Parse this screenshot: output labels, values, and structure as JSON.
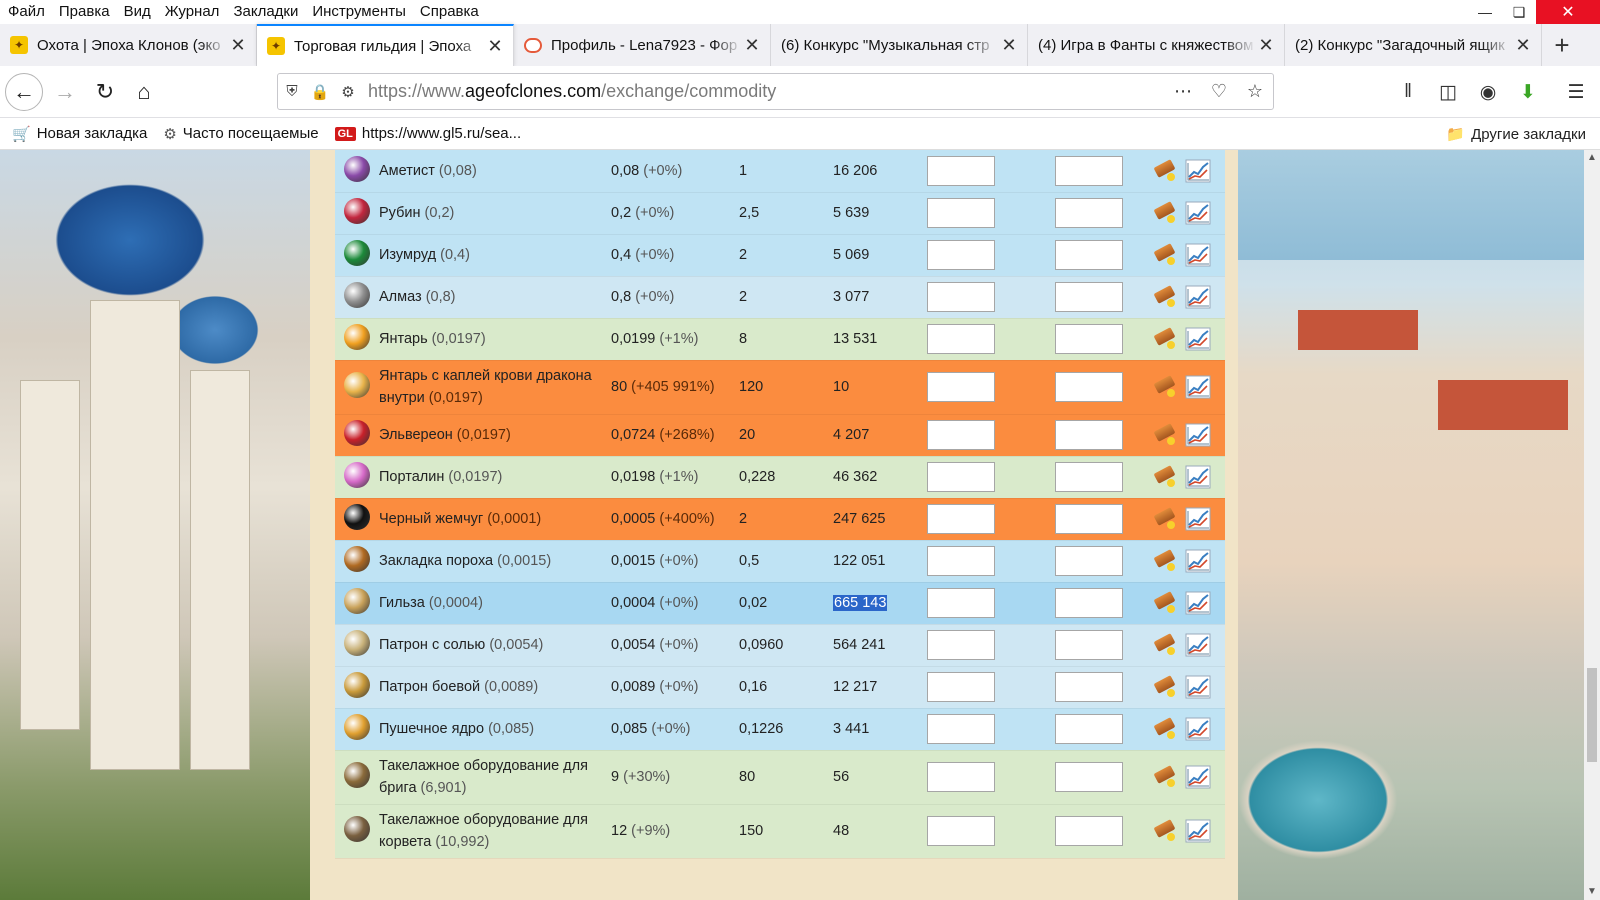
{
  "menu": [
    "Файл",
    "Правка",
    "Вид",
    "Журнал",
    "Закладки",
    "Инструменты",
    "Справка"
  ],
  "tabs": [
    {
      "title": "Охота | Эпоха Клонов (эко",
      "icon": "clone-favicon",
      "active": false
    },
    {
      "title": "Торговая гильдия | Эпоха",
      "icon": "clone-favicon",
      "active": true
    },
    {
      "title": "Профиль - Lena7923 - Фор",
      "icon": "chat-bubble-favicon",
      "active": false
    },
    {
      "title": "(6) Конкурс \"Музыкальная стр",
      "icon": "",
      "active": false
    },
    {
      "title": "(4) Игра в Фанты с княжеством",
      "icon": "",
      "active": false
    },
    {
      "title": "(2) Конкурс \"Загадочный ящик",
      "icon": "",
      "active": false
    }
  ],
  "url": {
    "prefix": "https://www.",
    "domain": "ageofclones.com",
    "path": "/exchange/commodity"
  },
  "bookmarks": [
    {
      "label": "Новая закладка",
      "icon": "cart-icon"
    },
    {
      "label": "Часто посещаемые",
      "icon": "gear-icon"
    },
    {
      "label": "https://www.gl5.ru/sea...",
      "icon": "gl-icon"
    }
  ],
  "bookmarks_other": "Другие закладки",
  "colors": {
    "blue": "#bfe3f4",
    "lightblue": "#cfe7f3",
    "green": "#d9eacb",
    "orange": "#fb8c3f",
    "selected": "#a8d8f2",
    "accent": "#0a84ff"
  },
  "rows": [
    {
      "name": "Аметист",
      "base": "(0,08)",
      "price": "0,08",
      "change": "(+0%)",
      "qty": "1",
      "stock": "16 206",
      "style": "blue",
      "icon_color": "#8a4aa8"
    },
    {
      "name": "Рубин",
      "base": "(0,2)",
      "price": "0,2",
      "change": "(+0%)",
      "qty": "2,5",
      "stock": "5 639",
      "style": "blue",
      "icon_color": "#c2263e"
    },
    {
      "name": "Изумруд",
      "base": "(0,4)",
      "price": "0,4",
      "change": "(+0%)",
      "qty": "2",
      "stock": "5 069",
      "style": "blue",
      "icon_color": "#1c8a3a"
    },
    {
      "name": "Алмаз",
      "base": "(0,8)",
      "price": "0,8",
      "change": "(+0%)",
      "qty": "2",
      "stock": "3 077",
      "style": "lightblue",
      "icon_color": "#8f8f8f"
    },
    {
      "name": "Янтарь",
      "base": "(0,0197)",
      "price": "0,0199",
      "change": "(+1%)",
      "qty": "8",
      "stock": "13 531",
      "style": "green",
      "icon_color": "#f0a020"
    },
    {
      "name": "Янтарь с каплей крови дракона внутри",
      "base": "(0,0197)",
      "price": "80",
      "change": "(+405 991%)",
      "qty": "120",
      "stock": "10",
      "style": "orange",
      "icon_color": "#e8b34a",
      "tall": true
    },
    {
      "name": "Эльвереон",
      "base": "(0,0197)",
      "price": "0,0724",
      "change": "(+268%)",
      "qty": "20",
      "stock": "4 207",
      "style": "orange",
      "icon_color": "#c8202a"
    },
    {
      "name": "Порталин",
      "base": "(0,0197)",
      "price": "0,0198",
      "change": "(+1%)",
      "qty": "0,228",
      "stock": "46 362",
      "style": "green",
      "icon_color": "#d66ac8"
    },
    {
      "name": "Черный жемчуг",
      "base": "(0,0001)",
      "price": "0,0005",
      "change": "(+400%)",
      "qty": "2",
      "stock": "247 625",
      "style": "orange",
      "icon_color": "#111111"
    },
    {
      "name": "Закладка пороха",
      "base": "(0,0015)",
      "price": "0,0015",
      "change": "(+0%)",
      "qty": "0,5",
      "stock": "122 051",
      "style": "blue",
      "icon_color": "#b06a22"
    },
    {
      "name": "Гильза",
      "base": "(0,0004)",
      "price": "0,0004",
      "change": "(+0%)",
      "qty": "0,02",
      "stock": "665 143",
      "style": "selected",
      "icon_color": "#c9a25a",
      "stock_highlight": true
    },
    {
      "name": "Патрон с солью",
      "base": "(0,0054)",
      "price": "0,0054",
      "change": "(+0%)",
      "qty": "0,0960",
      "stock": "564 241",
      "style": "lightblue",
      "icon_color": "#c9b27a"
    },
    {
      "name": "Патрон боевой",
      "base": "(0,0089)",
      "price": "0,0089",
      "change": "(+0%)",
      "qty": "0,16",
      "stock": "12 217",
      "style": "lightblue",
      "icon_color": "#c99a3a"
    },
    {
      "name": "Пушечное ядро",
      "base": "(0,085)",
      "price": "0,085",
      "change": "(+0%)",
      "qty": "0,1226",
      "stock": "3 441",
      "style": "blue",
      "icon_color": "#e0a030"
    },
    {
      "name": "Такелажное оборудование для брига",
      "base": "(6,901)",
      "price": "9",
      "change": "(+30%)",
      "qty": "80",
      "stock": "56",
      "style": "green",
      "icon_color": "#8a6a3a",
      "tall": true
    },
    {
      "name": "Такелажное оборудование для корвета",
      "base": "(10,992)",
      "price": "12",
      "change": "(+9%)",
      "qty": "150",
      "stock": "48",
      "style": "green",
      "icon_color": "#7a6040",
      "tall": true
    }
  ]
}
